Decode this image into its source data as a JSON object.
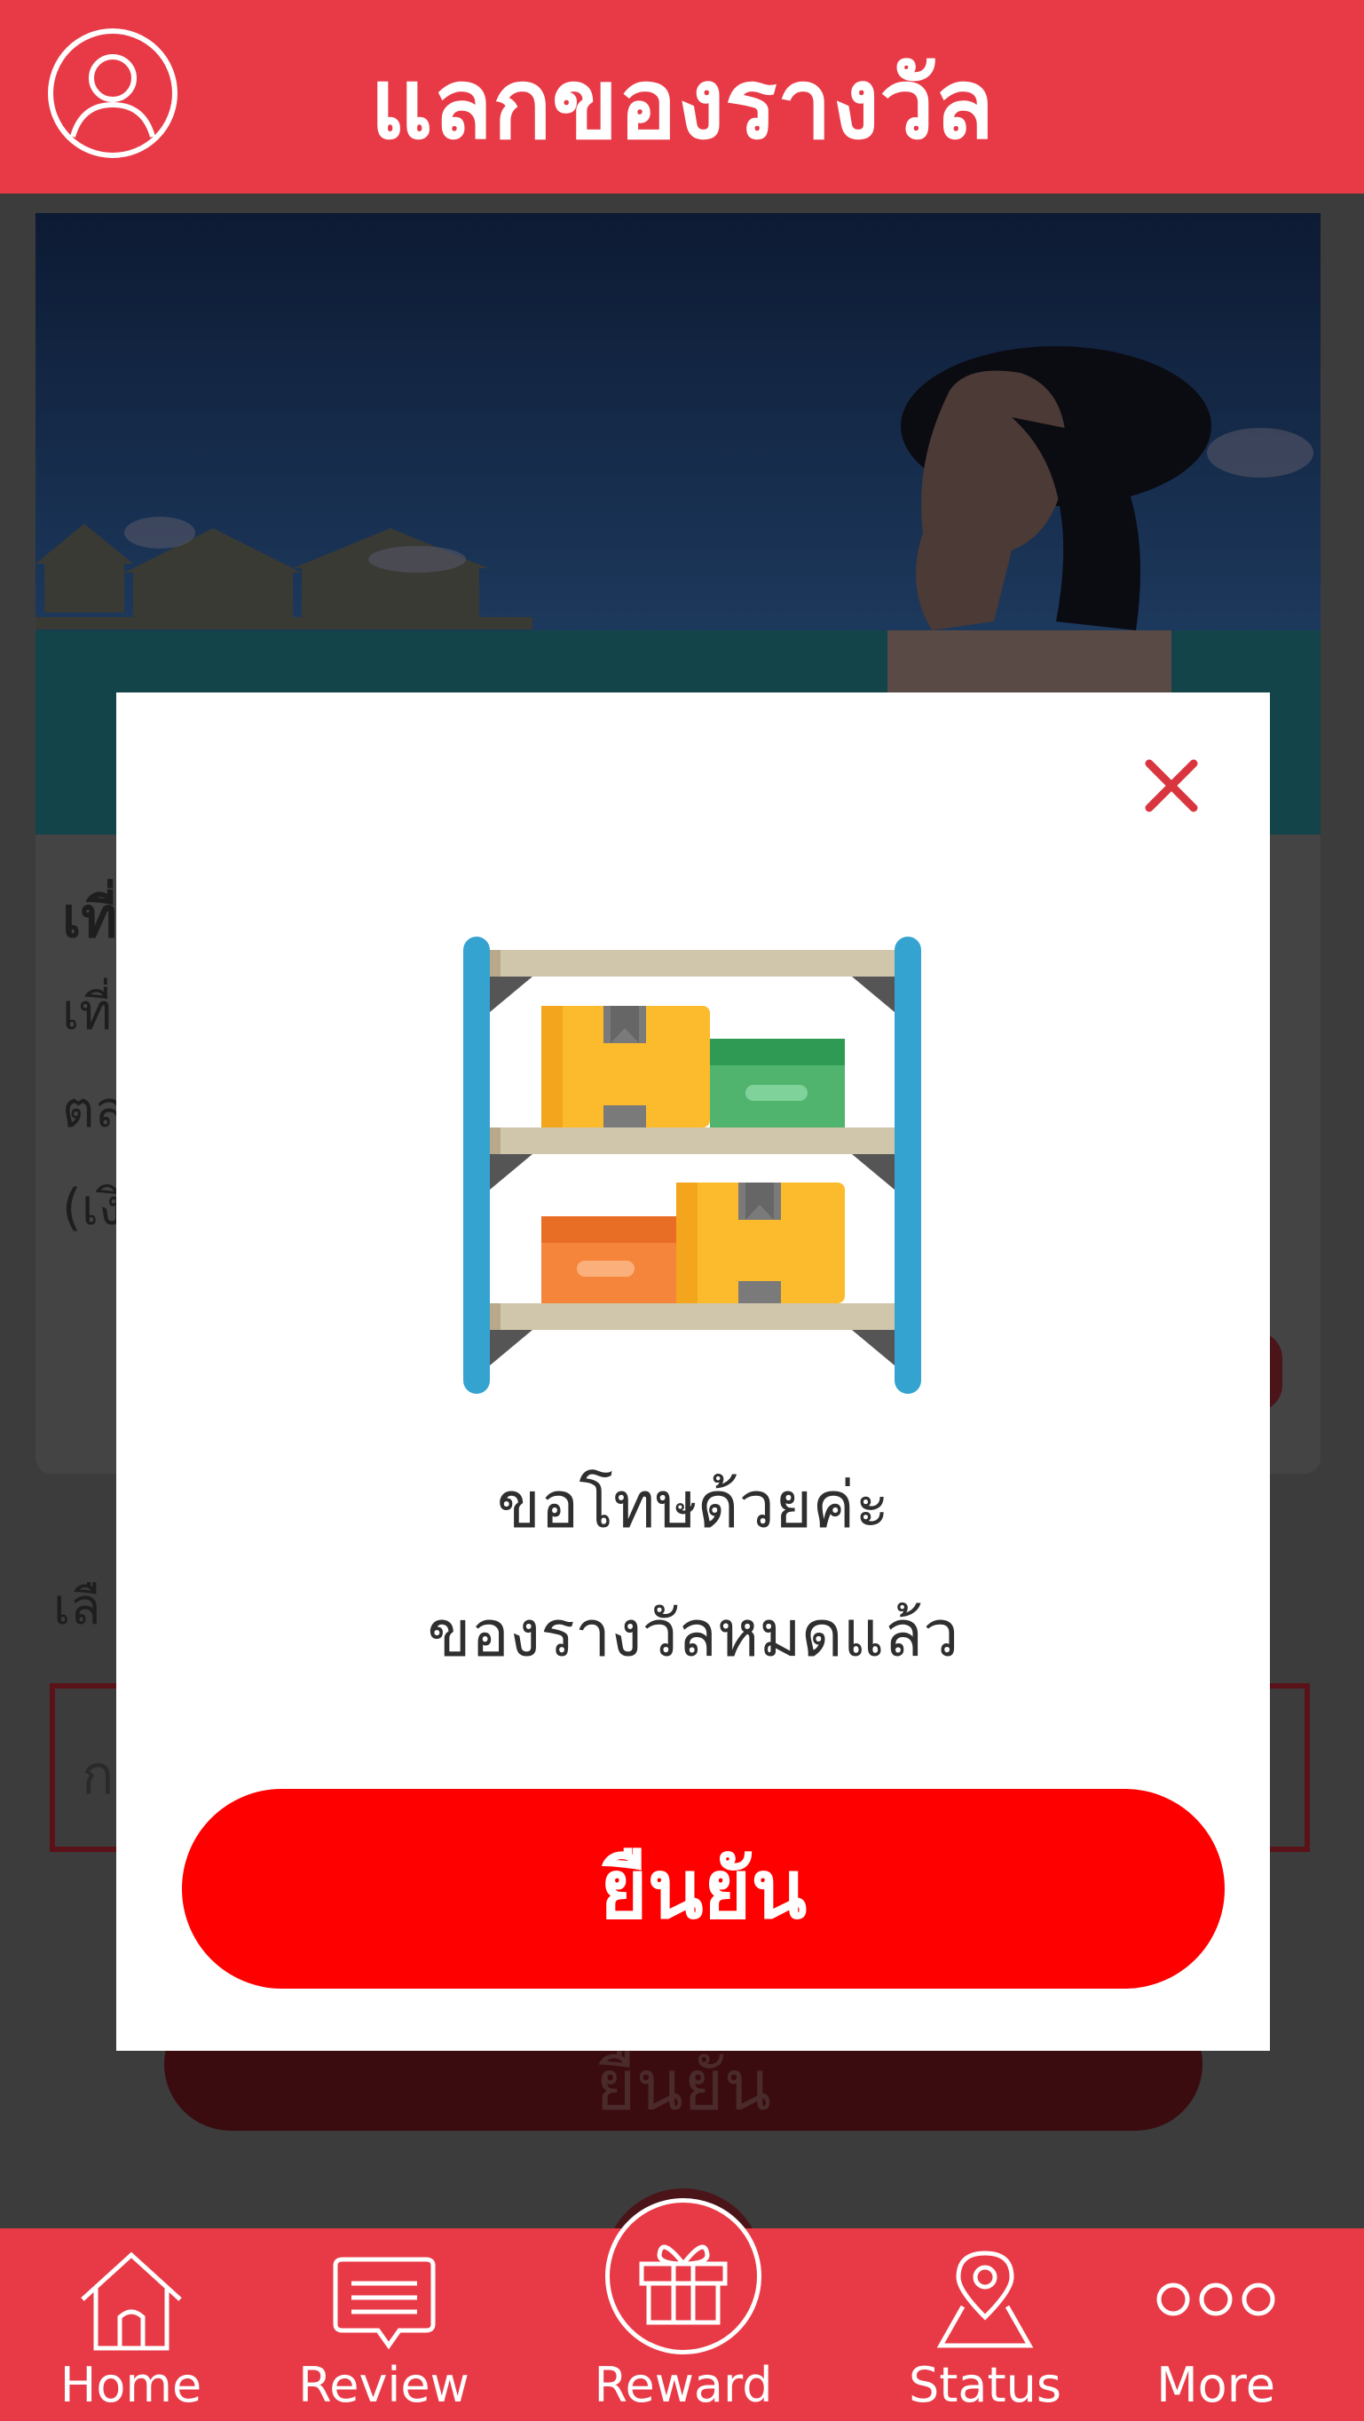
{
  "header": {
    "title": "แลกของรางวัล",
    "avatar_icon": "user-circle-icon"
  },
  "colors": {
    "brand_red": "#e83a46",
    "confirm_red": "#ff0000"
  },
  "background_card": {
    "title": "เที่",
    "lines": [
      "เที่",
      "ตล",
      "(เงิ"
    ],
    "section_label": "เลื",
    "input_value": "ก",
    "confirm_label": "ยืนยัน"
  },
  "modal": {
    "close_icon": "close-icon",
    "illustration_icon": "empty-shelf-icon",
    "message_line1": "ขอโทษด้วยค่ะ",
    "message_line2": "ของรางวัลหมดแล้ว",
    "confirm_label": "ยืนยัน"
  },
  "bottom_nav": {
    "items": [
      {
        "label": "Home",
        "icon": "home-icon"
      },
      {
        "label": "Review",
        "icon": "review-icon"
      },
      {
        "label": "Reward",
        "icon": "gift-icon"
      },
      {
        "label": "Status",
        "icon": "map-pin-icon"
      },
      {
        "label": "More",
        "icon": "more-icon"
      }
    ]
  }
}
